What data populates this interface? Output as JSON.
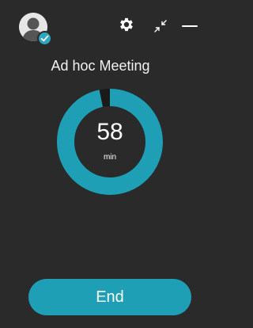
{
  "meeting": {
    "title": "Ad hoc Meeting",
    "remaining_value": "58",
    "remaining_unit": "min",
    "progress_fraction": 0.967
  },
  "toolbar": {
    "avatar_status": "verified",
    "icons": [
      "settings-icon",
      "collapse-icon",
      "minimize-icon"
    ]
  },
  "actions": {
    "end_label": "End"
  },
  "colors": {
    "background": "#2a2a2a",
    "accent": "#1f9fb5",
    "ring_track": "#1a1a1a",
    "text": "#ffffff"
  }
}
